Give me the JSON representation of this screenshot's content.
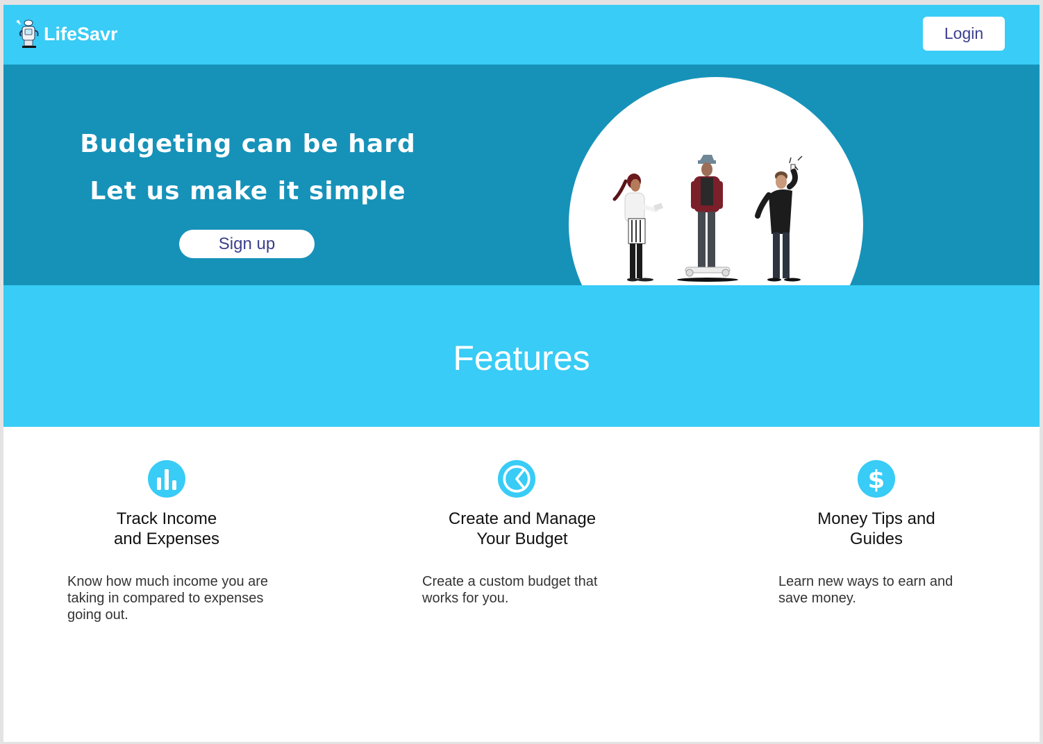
{
  "nav": {
    "brand_name": "LifeSavr",
    "brand_icon": "robot-logo-icon",
    "login_label": "Login"
  },
  "hero": {
    "line1": "Budgeting can be hard",
    "line2": "Let us make it simple",
    "signup_label": "Sign up",
    "illustration": "people-illustration"
  },
  "features": {
    "title": "Features",
    "items": [
      {
        "icon": "bar-chart-icon",
        "title": "Track Income\nand Expenses",
        "description": "Know how much income you are taking in compared to expenses going out."
      },
      {
        "icon": "pie-chart-icon",
        "title": "Create and Manage\nYour Budget",
        "description": "Create a custom budget that works for you."
      },
      {
        "icon": "dollar-icon",
        "title": "Money Tips and\nGuides",
        "description": "Learn new ways to earn and save money."
      }
    ]
  },
  "colors": {
    "nav_bg": "#38ccf6",
    "hero_bg": "#1692b9",
    "button_text": "#3b3f8c"
  }
}
